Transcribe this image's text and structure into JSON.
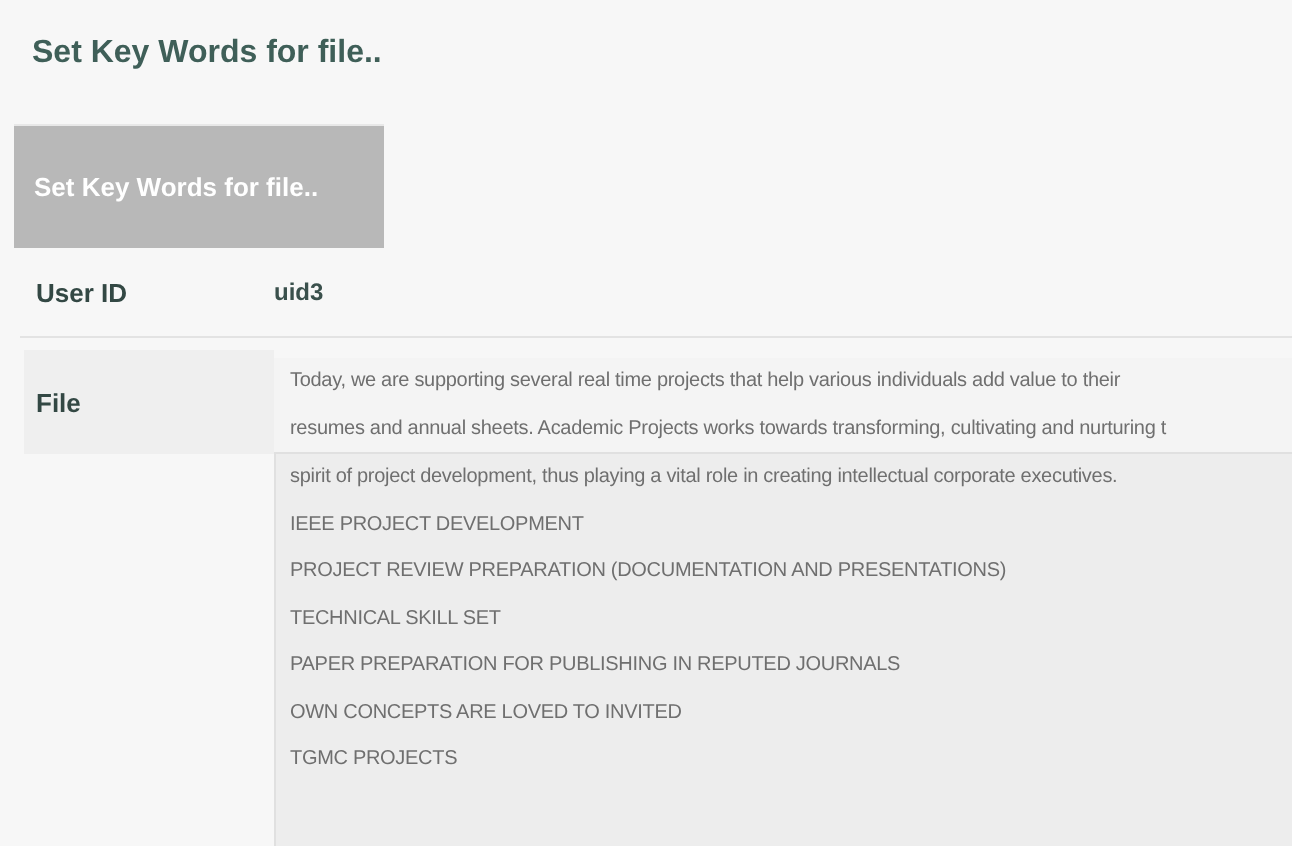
{
  "page_title": "Set Key Words for file..",
  "ghost_title": "Set Key Words for file..",
  "fields": [
    {
      "label": "User ID",
      "value": "uid3"
    }
  ],
  "file": {
    "label": "File",
    "lines": [
      "Today, we are supporting several real time projects that help various individuals add value to their",
      "resumes and annual sheets.  Academic Projects works towards transforming, cultivating and nurturing t",
      "spirit of project development, thus playing a vital role in creating intellectual corporate executives.",
      "IEEE PROJECT DEVELOPMENT",
      "PROJECT REVIEW PREPARATION (DOCUMENTATION AND PRESENTATIONS)",
      "TECHNICAL SKILL SET",
      "PAPER PREPARATION FOR PUBLISHING IN REPUTED JOURNALS",
      "OWN CONCEPTS ARE LOVED TO INVITED",
      "TGMC PROJECTS"
    ]
  }
}
